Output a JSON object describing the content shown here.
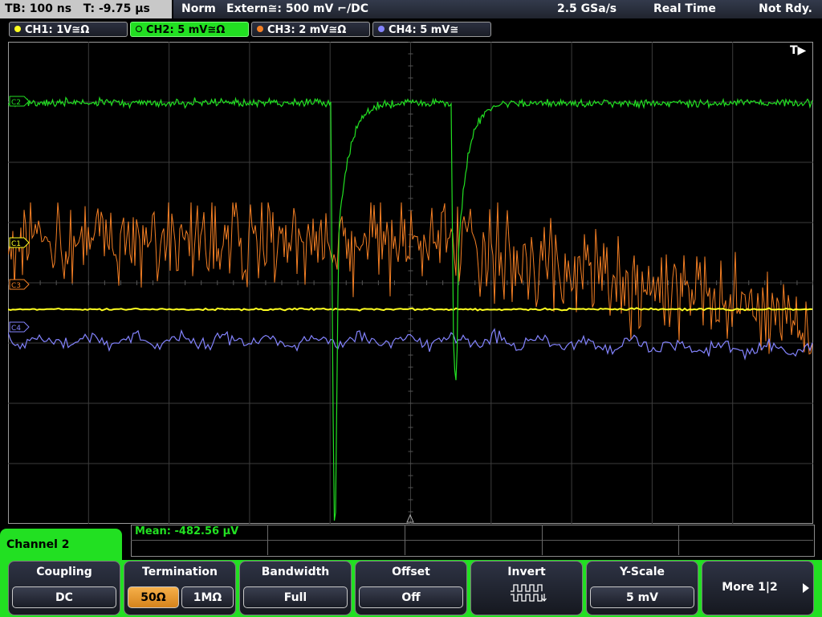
{
  "status": {
    "timebase": "TB: 100 ns   T: -9.75 µs",
    "mode": "Norm",
    "trigger": "Extern≅: 500 mV ⌐/DC",
    "sample_rate": "2.5 GSa/s",
    "acq_mode": "Real Time",
    "trigger_state": "Not Rdy."
  },
  "channels": [
    {
      "label": "CH1: 1V≅Ω",
      "color": "#ffff20",
      "active": false
    },
    {
      "label": "CH2: 5 mV≅Ω",
      "color": "#22e022",
      "active": true
    },
    {
      "label": "CH3: 2 mV≅Ω",
      "color": "#f47f24",
      "active": false
    },
    {
      "label": "CH4: 5 mV≅",
      "color": "#8484ff",
      "active": false
    }
  ],
  "markers": {
    "c1": "C1",
    "c2": "C2",
    "c3": "C3",
    "c4": "C4",
    "trigger": "T▶"
  },
  "measurement": {
    "mean": "Mean: -482.56 µV"
  },
  "menu": {
    "title": "Channel 2",
    "coupling": {
      "title": "Coupling",
      "value": "DC"
    },
    "termination": {
      "title": "Termination",
      "options": [
        "50Ω",
        "1MΩ"
      ],
      "selected": "50Ω"
    },
    "bandwidth": {
      "title": "Bandwidth",
      "value": "Full"
    },
    "offset": {
      "title": "Offset",
      "value": "Off"
    },
    "invert": {
      "title": "Invert",
      "icon": "invert-square-wave-icon"
    },
    "yscale": {
      "title": "Y-Scale",
      "value": "5 mV"
    },
    "more": {
      "label": "More 1|2"
    }
  }
}
